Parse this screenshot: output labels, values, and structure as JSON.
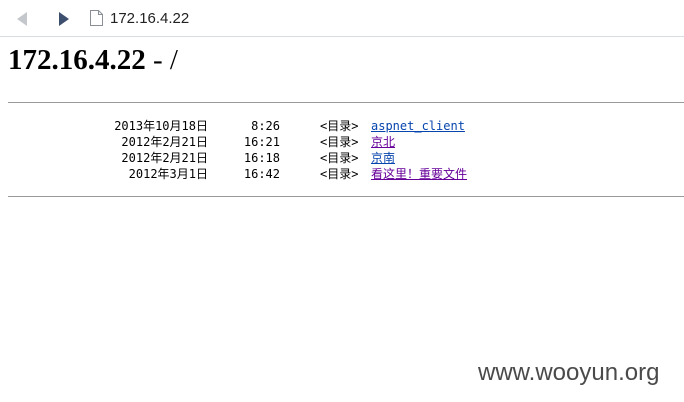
{
  "browser": {
    "url": "172.16.4.22",
    "icons": {
      "back": "back-arrow-icon",
      "forward": "forward-arrow-icon",
      "page": "page-icon"
    },
    "colors": {
      "back_disabled": "#c4c8cc",
      "forward_active": "#3d4f6e"
    }
  },
  "page": {
    "title_host": "172.16.4.22",
    "title_path": " - /",
    "listing": [
      {
        "date": "2013年10月18日",
        "time": "8:26",
        "tag": "<目录>",
        "name": "aspnet_client"
      },
      {
        "date": "2012年2月21日",
        "time": "16:21",
        "tag": "<目录>",
        "name": "京北"
      },
      {
        "date": "2012年2月21日",
        "time": "16:18",
        "tag": "<目录>",
        "name": "京南"
      },
      {
        "date": "2012年3月1日",
        "time": "16:42",
        "tag": "<目录>",
        "name": "看这里！重要文件"
      }
    ],
    "link_colors": {
      "unvisited": "#0645ad",
      "visited": "#660099"
    }
  },
  "watermark": "www.wooyun.org"
}
